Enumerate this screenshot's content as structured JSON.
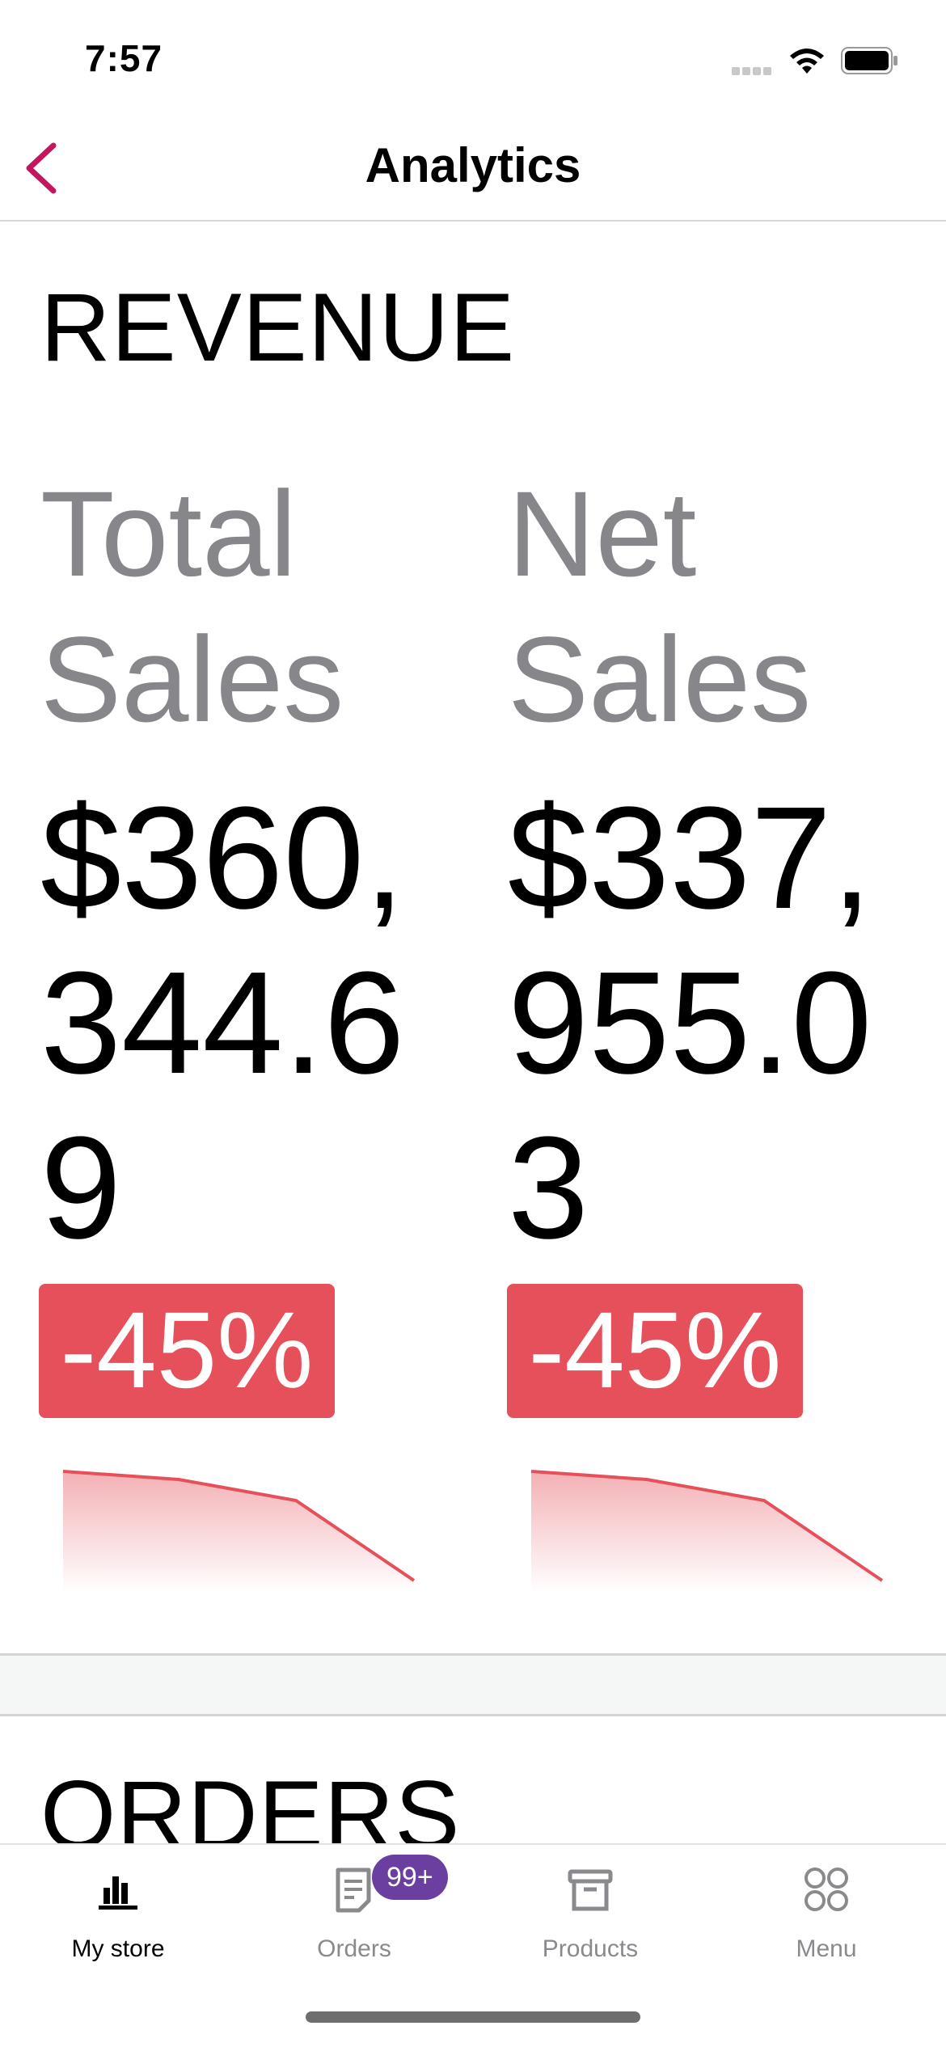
{
  "status_bar": {
    "time": "7:57"
  },
  "nav": {
    "title": "Analytics"
  },
  "revenue": {
    "heading": "REVENUE",
    "total_sales": {
      "label": "Total Sales",
      "value": "$360,344.69",
      "delta": "-45%"
    },
    "net_sales": {
      "label": "Net Sales",
      "value": "$337,955.03",
      "delta": "-45%"
    },
    "negative_color": "#e5505a"
  },
  "orders": {
    "heading": "ORDERS"
  },
  "tab_bar": {
    "tabs": [
      {
        "label": "My store",
        "icon": "bar-chart-icon",
        "active": true
      },
      {
        "label": "Orders",
        "icon": "orders-icon",
        "badge": "99+"
      },
      {
        "label": "Products",
        "icon": "archive-box-icon"
      },
      {
        "label": "Menu",
        "icon": "menu-grid-icon"
      }
    ]
  },
  "colors": {
    "accent": "#c2185b",
    "badge": "#6a3fa0"
  }
}
